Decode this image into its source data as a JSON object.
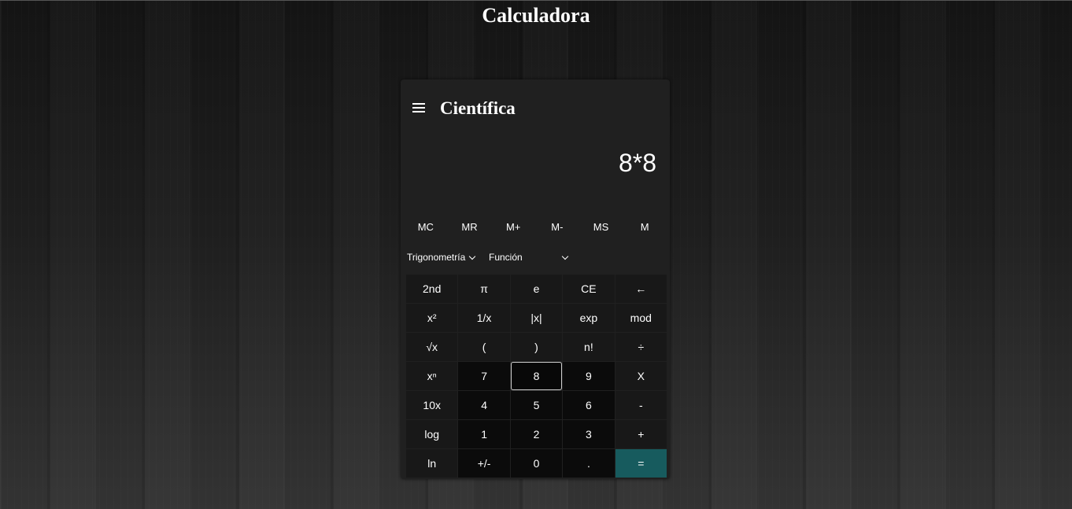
{
  "page": {
    "title": "Calculadora"
  },
  "calculator": {
    "mode_title": "Científica",
    "display_value": "8*8",
    "memory": [
      "MC",
      "MR",
      "M+",
      "M-",
      "MS",
      "M"
    ],
    "trig_label": "Trigonometría",
    "func_label": "Función",
    "keys": [
      {
        "label": "2nd",
        "name": "key-2nd",
        "type": "fn"
      },
      {
        "label": "π",
        "name": "key-pi",
        "type": "fn"
      },
      {
        "label": "e",
        "name": "key-e",
        "type": "fn"
      },
      {
        "label": "CE",
        "name": "key-ce",
        "type": "fn"
      },
      {
        "label": "←",
        "name": "key-backspace",
        "type": "fn"
      },
      {
        "label": "x²",
        "name": "key-square",
        "type": "fn"
      },
      {
        "label": "1/x",
        "name": "key-reciprocal",
        "type": "fn"
      },
      {
        "label": "|x|",
        "name": "key-abs",
        "type": "fn"
      },
      {
        "label": "exp",
        "name": "key-exp",
        "type": "fn"
      },
      {
        "label": "mod",
        "name": "key-mod",
        "type": "fn"
      },
      {
        "label": "√x",
        "name": "key-sqrt",
        "type": "fn"
      },
      {
        "label": "(",
        "name": "key-open-paren",
        "type": "fn"
      },
      {
        "label": ")",
        "name": "key-close-paren",
        "type": "fn"
      },
      {
        "label": "n!",
        "name": "key-factorial",
        "type": "fn"
      },
      {
        "label": "÷",
        "name": "key-divide",
        "type": "fn"
      },
      {
        "label": "xⁿ",
        "name": "key-power",
        "type": "fn"
      },
      {
        "label": "7",
        "name": "key-7",
        "type": "num"
      },
      {
        "label": "8",
        "name": "key-8",
        "type": "num",
        "focused": true
      },
      {
        "label": "9",
        "name": "key-9",
        "type": "num"
      },
      {
        "label": "X",
        "name": "key-multiply",
        "type": "fn"
      },
      {
        "label": "10x",
        "name": "key-ten-power",
        "type": "fn"
      },
      {
        "label": "4",
        "name": "key-4",
        "type": "num"
      },
      {
        "label": "5",
        "name": "key-5",
        "type": "num"
      },
      {
        "label": "6",
        "name": "key-6",
        "type": "num"
      },
      {
        "label": "-",
        "name": "key-subtract",
        "type": "fn"
      },
      {
        "label": "log",
        "name": "key-log",
        "type": "fn"
      },
      {
        "label": "1",
        "name": "key-1",
        "type": "num"
      },
      {
        "label": "2",
        "name": "key-2",
        "type": "num"
      },
      {
        "label": "3",
        "name": "key-3",
        "type": "num"
      },
      {
        "label": "+",
        "name": "key-add",
        "type": "fn"
      },
      {
        "label": "ln",
        "name": "key-ln",
        "type": "fn"
      },
      {
        "label": "+/-",
        "name": "key-negate",
        "type": "num"
      },
      {
        "label": "0",
        "name": "key-0",
        "type": "num"
      },
      {
        "label": ".",
        "name": "key-decimal",
        "type": "num"
      },
      {
        "label": "=",
        "name": "key-equals",
        "type": "equals"
      }
    ]
  },
  "colors": {
    "equals": "#175b5e",
    "panel": "#202020"
  }
}
